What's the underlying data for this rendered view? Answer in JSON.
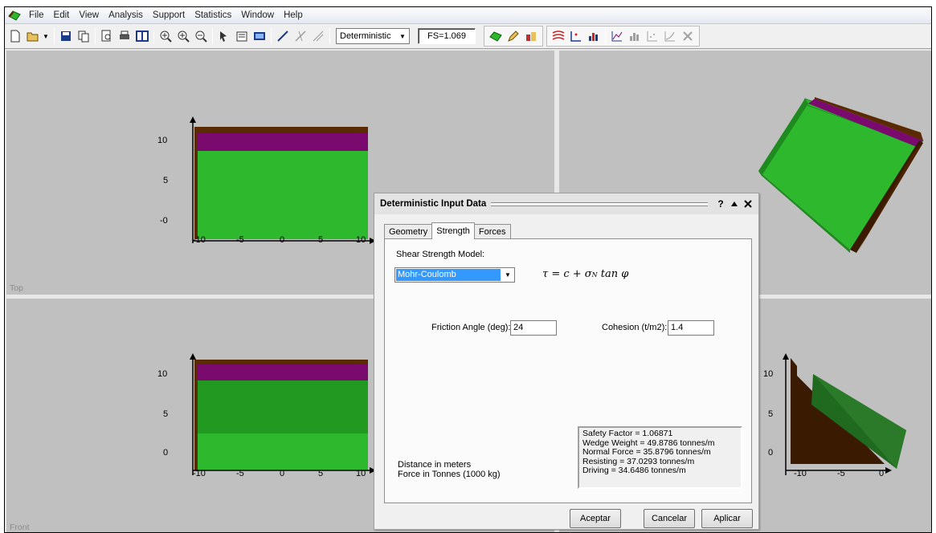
{
  "menu": [
    "File",
    "Edit",
    "View",
    "Analysis",
    "Support",
    "Statistics",
    "Window",
    "Help"
  ],
  "toolbar": {
    "mode_select": "Deterministic",
    "fs_value": "FS=1.069"
  },
  "viewports": {
    "top": {
      "label": "Top",
      "y_ticks": [
        "10",
        "5",
        "-0"
      ],
      "x_ticks": [
        "-10",
        "-5",
        "0",
        "5",
        "10"
      ]
    },
    "front": {
      "label": "Front",
      "y_ticks": [
        "10",
        "5",
        "0"
      ],
      "x_ticks": [
        "-10",
        "-5",
        "0",
        "5",
        "10"
      ]
    },
    "side": {
      "y_ticks": [
        "10",
        "5",
        "0"
      ],
      "x_ticks": [
        "-10",
        "-5",
        "0"
      ]
    }
  },
  "colors": {
    "viewport_bg": "#c0c0c0",
    "soil_green": "#2eb82e",
    "dark_green": "#1f8a1f",
    "purple": "#7a0a6e",
    "brown": "#5a2a00",
    "highlight": "#3399ff"
  },
  "dialog": {
    "title": "Deterministic Input Data",
    "help_icon": "question-icon",
    "tabs": [
      "Geometry",
      "Strength",
      "Forces"
    ],
    "active_tab": "Strength",
    "shear_model_label": "Shear Strength Model:",
    "shear_model_value": "Mohr-Coulomb",
    "formula": {
      "lhs": "τ = c + σ",
      "sub": "N",
      "rhs": " tan φ"
    },
    "friction_label": "Friction Angle (deg):",
    "friction_value": "24",
    "cohesion_label": "Cohesion (t/m2):",
    "cohesion_value": "1.4",
    "results": [
      "Safety Factor = 1.06871",
      "Wedge Weight = 49.8786 tonnes/m",
      "Normal Force = 35.8796 tonnes/m",
      "Resisting = 37.0293 tonnes/m",
      "Driving = 34.6486 tonnes/m"
    ],
    "units": [
      "Distance in meters",
      "Force in Tonnes (1000 kg)"
    ],
    "buttons": {
      "accept": "Aceptar",
      "cancel": "Cancelar",
      "apply": "Aplicar"
    }
  }
}
